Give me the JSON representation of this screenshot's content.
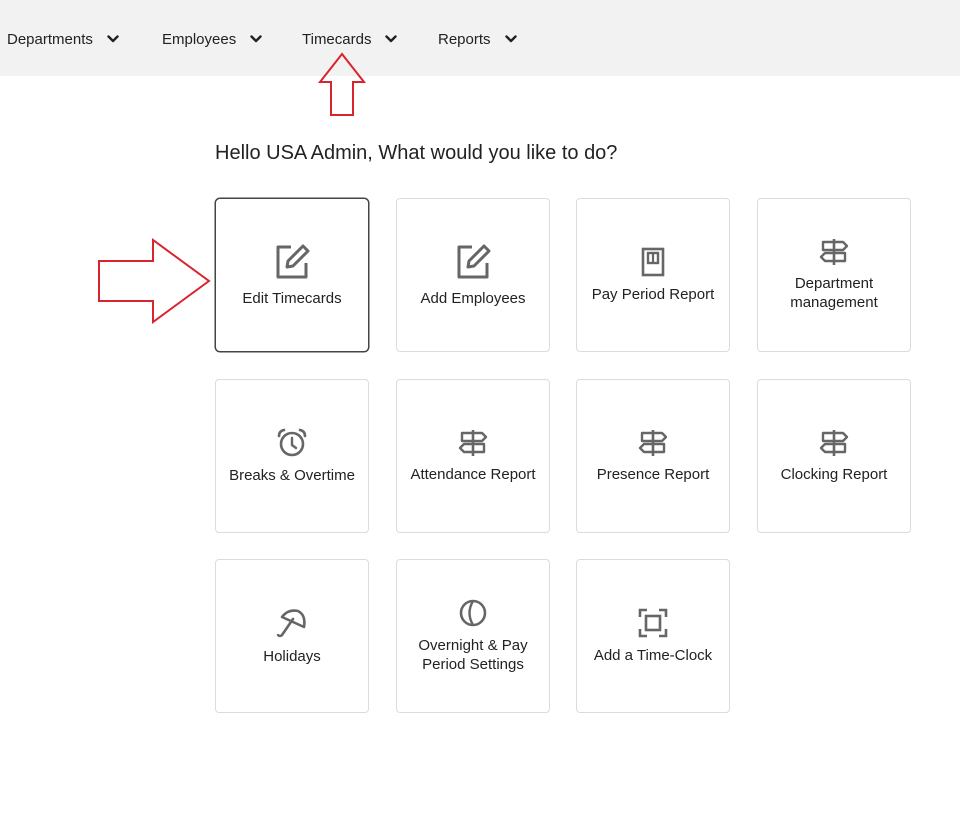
{
  "nav": {
    "items": [
      {
        "label": "Departments"
      },
      {
        "label": "Employees"
      },
      {
        "label": "Timecards"
      },
      {
        "label": "Reports"
      }
    ]
  },
  "greeting": "Hello USA Admin, What would you like to do?",
  "cards": [
    {
      "label": "Edit Timecards",
      "icon": "edit-icon",
      "selected": true
    },
    {
      "label": "Add Employees",
      "icon": "edit-icon"
    },
    {
      "label": "Pay Period Report",
      "icon": "report-icon"
    },
    {
      "label": "Department management",
      "icon": "signpost-icon"
    },
    {
      "label": "Breaks & Overtime",
      "icon": "alarm-clock-icon"
    },
    {
      "label": "Attendance Report",
      "icon": "signpost-icon"
    },
    {
      "label": "Presence Report",
      "icon": "signpost-icon"
    },
    {
      "label": "Clocking Report",
      "icon": "signpost-icon"
    },
    {
      "label": "Holidays",
      "icon": "umbrella-icon"
    },
    {
      "label": "Overnight & Pay Period Settings",
      "icon": "moon-icon"
    },
    {
      "label": "Add a Time-Clock",
      "icon": "scan-frame-icon"
    }
  ],
  "colors": {
    "nav_bg": "#f2f2f2",
    "annotation_arrow": "#d9232d",
    "icon": "#666666"
  }
}
